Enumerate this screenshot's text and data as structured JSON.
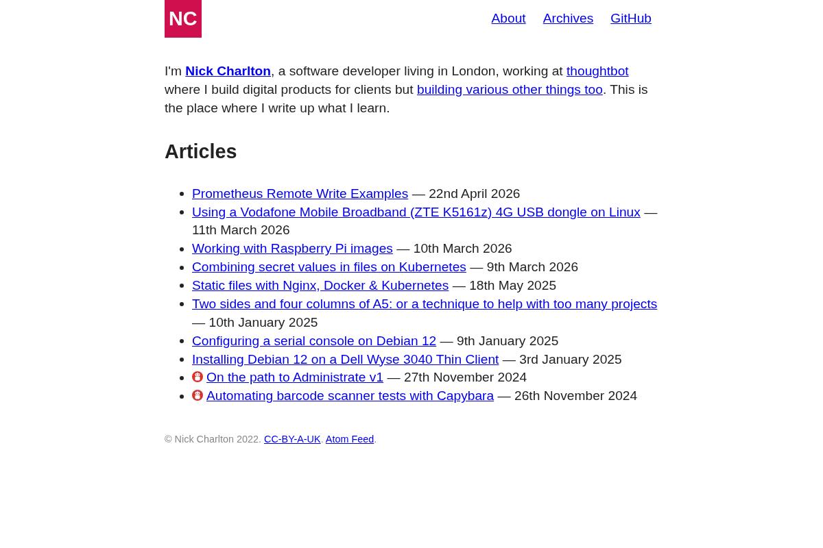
{
  "logo": {
    "text": "NC"
  },
  "nav": [
    {
      "label": "About"
    },
    {
      "label": "Archives"
    },
    {
      "label": "GitHub"
    }
  ],
  "intro": [
    {
      "kind": "text",
      "text": "I'm "
    },
    {
      "kind": "strong_link",
      "text": "Nick Charlton"
    },
    {
      "kind": "text",
      "text": ", a software developer living in London, working at "
    },
    {
      "kind": "link",
      "text": "thoughtbot"
    },
    {
      "kind": "text",
      "text": " where I build digital products for clients but "
    },
    {
      "kind": "link",
      "text": "building various other things too"
    },
    {
      "kind": "text",
      "text": ". This is the place where I write up what I learn."
    }
  ],
  "articles_heading": "Articles",
  "articles": [
    {
      "title": "Prometheus Remote Write Examples",
      "date": "— 22nd April 2026",
      "badge": false
    },
    {
      "title": "Using a Vodafone Mobile Broadband (ZTE K5161z) 4G USB dongle on Linux",
      "date": "— 11th March 2026",
      "badge": false
    },
    {
      "title": "Working with Raspberry Pi images",
      "date": "— 10th March 2026",
      "badge": false
    },
    {
      "title": "Combining secret values in files on Kubernetes",
      "date": "— 9th March 2026",
      "badge": false
    },
    {
      "title": "Static files with Nginx, Docker & Kubernetes",
      "date": "— 18th May 2025",
      "badge": false
    },
    {
      "title": "Two sides and four columns of A5: or a technique to help with too many projects",
      "date": "— 10th January 2025",
      "badge": false
    },
    {
      "title": "Configuring a serial console on Debian 12",
      "date": "— 9th January 2025",
      "badge": false
    },
    {
      "title": "Installing Debian 12 on a Dell Wyse 3040 Thin Client",
      "date": "— 3rd January 2025",
      "badge": false
    },
    {
      "title": "On the path to Administrate v1",
      "date": "— 27th November 2024",
      "badge": true
    },
    {
      "title": "Automating barcode scanner tests with Capybara",
      "date": "— 26th November 2024",
      "badge": true
    }
  ],
  "footer": [
    {
      "kind": "text",
      "text": "© Nick Charlton 2022. "
    },
    {
      "kind": "link",
      "text": "CC-BY-A-UK"
    },
    {
      "kind": "text",
      "text": ". "
    },
    {
      "kind": "link",
      "text": "Atom Feed"
    },
    {
      "kind": "text",
      "text": "."
    }
  ]
}
